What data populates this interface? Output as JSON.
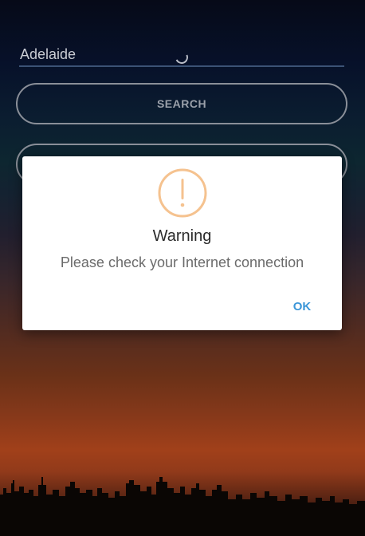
{
  "search_form": {
    "city_value": "Adelaide",
    "search_label": "SEARCH",
    "second_label": ""
  },
  "dialog": {
    "icon": "warning-icon",
    "title": "Warning",
    "message": "Please check your Internet connection",
    "ok_label": "OK"
  },
  "colors": {
    "accent": "#3b96d8",
    "warning": "#f5c28f"
  }
}
